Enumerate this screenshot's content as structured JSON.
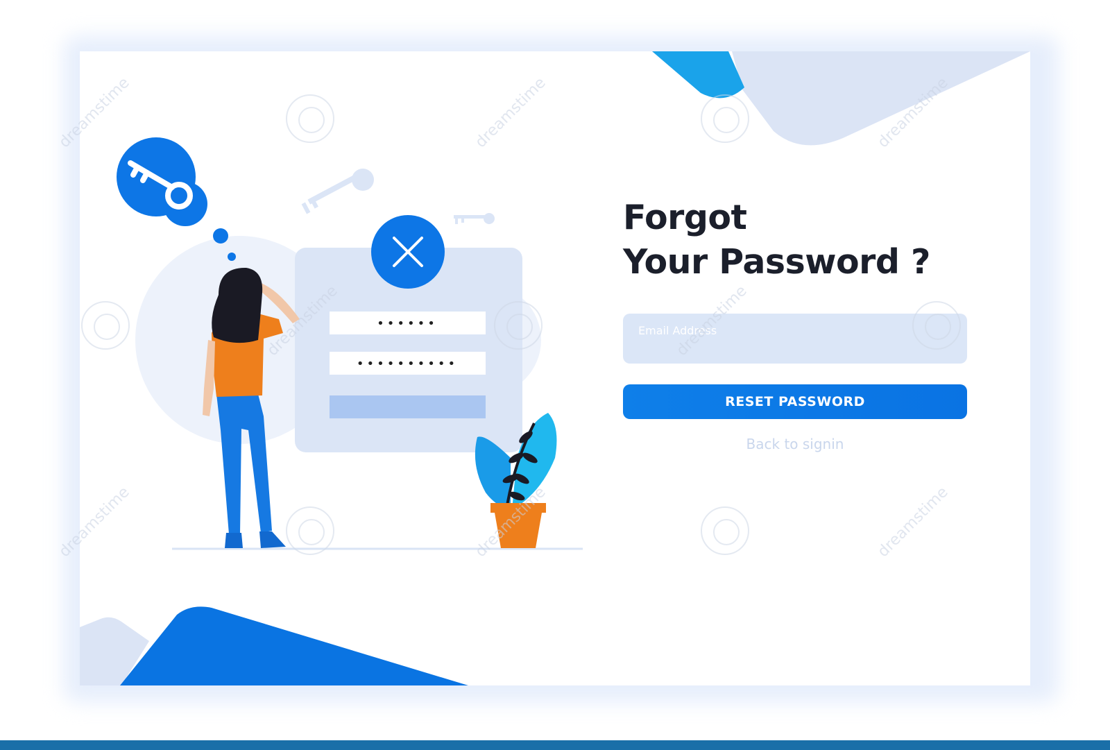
{
  "page": {
    "title_line1": "Forgot",
    "title_line2": "Your Password ?",
    "email_placeholder": "Email Address",
    "email_value": "",
    "reset_button_label": "RESET PASSWORD",
    "back_link_label": "Back to signin"
  },
  "illustration": {
    "password_field_1_mask": "••••••",
    "password_field_2_mask": "••••••••••"
  },
  "watermark": {
    "text": "dreamstime"
  },
  "colors": {
    "accent": "#0e7fe9",
    "light_accent": "#dbe6f7",
    "heading": "#1b1f2b",
    "muted_link": "#c9d6ec",
    "bottom_bar": "#1a6fa8"
  }
}
